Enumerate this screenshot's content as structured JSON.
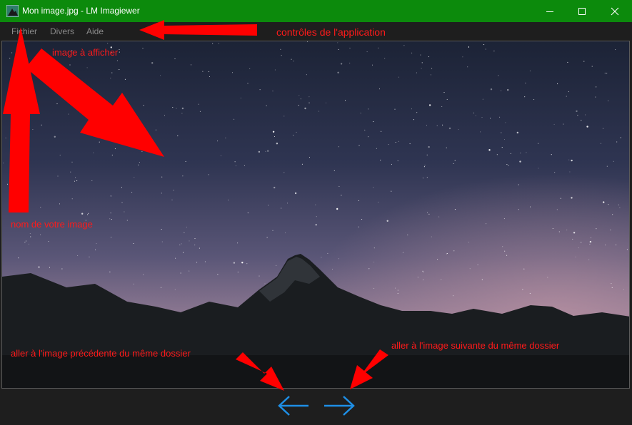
{
  "window": {
    "title": "Mon image.jpg - LM Imagiewer",
    "titlebar_color": "#0c8a0c",
    "controls": [
      "minimize-icon",
      "maximize-icon",
      "close-icon"
    ]
  },
  "menu": {
    "items": [
      {
        "label": "Fichier"
      },
      {
        "label": "Divers"
      },
      {
        "label": "Aide"
      }
    ]
  },
  "navigation": {
    "prev_icon": "arrow-left-icon",
    "next_icon": "arrow-right-icon",
    "accent": "#1e8fe6"
  },
  "annotations": {
    "controls": "contrôles de l'application",
    "image": "image à afficher",
    "name": "nom de votre image",
    "prev": "aller à l'image précédente du même dossier",
    "next": "aller à l'image suivante du même dossier",
    "color": "#ff1a1a"
  }
}
